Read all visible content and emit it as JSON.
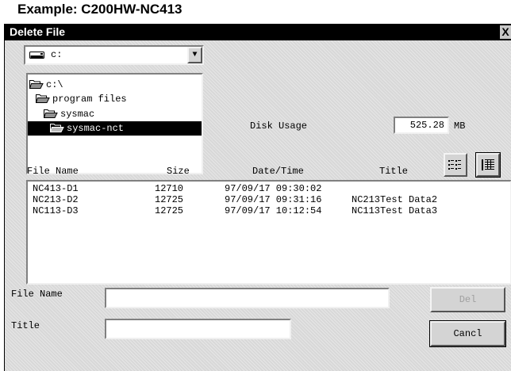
{
  "caption": "Example: C200HW-NC413",
  "dialog": {
    "title": "Delete File",
    "close_label": "X"
  },
  "drive": {
    "selected": "c:"
  },
  "tree": {
    "items": [
      {
        "label": "c:\\",
        "icon": "folder-open-icon",
        "selected": false
      },
      {
        "label": "program files",
        "icon": "folder-open-icon",
        "selected": false
      },
      {
        "label": "sysmac",
        "icon": "folder-open-icon",
        "selected": false
      },
      {
        "label": "sysmac-nct",
        "icon": "folder-open-icon",
        "selected": true
      }
    ]
  },
  "disk_usage": {
    "label": "Disk Usage",
    "value": "525.28",
    "unit": "MB"
  },
  "columns": {
    "name": "File Name",
    "size": "Size",
    "datetime": "Date/Time",
    "title": "Title"
  },
  "files": [
    {
      "name": "NC413-D1",
      "size": "12710",
      "datetime": "97/09/17 09:30:02",
      "title": ""
    },
    {
      "name": "NC213-D2",
      "size": "12725",
      "datetime": "97/09/17 09:31:16",
      "title": "NC213Test Data2"
    },
    {
      "name": "NC113-D3",
      "size": "12725",
      "datetime": "97/09/17 10:12:54",
      "title": "NC113Test Data3"
    }
  ],
  "form": {
    "file_name_label": "File Name",
    "file_name_value": "",
    "title_label": "Title",
    "title_value": ""
  },
  "buttons": {
    "delete": "Del",
    "cancel": "Cancl"
  },
  "icons": {
    "drive": "hard-drive-icon",
    "list_view": "list-view-icon",
    "details_view": "details-view-icon"
  }
}
